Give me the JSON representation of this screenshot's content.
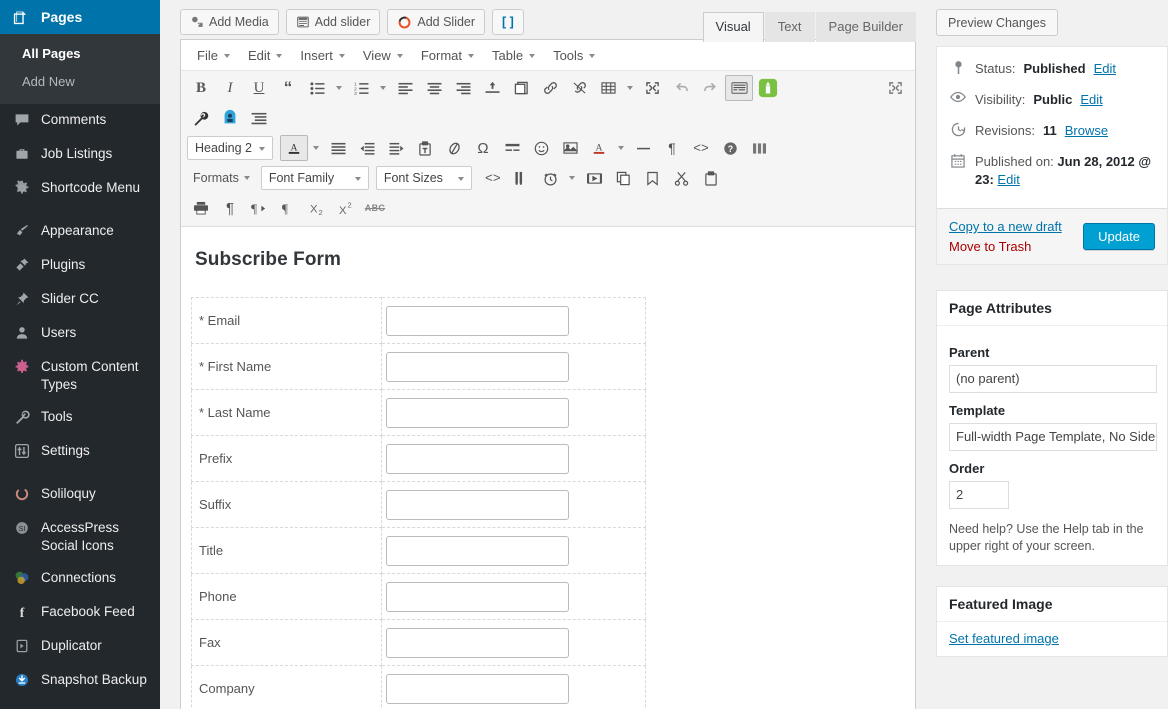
{
  "sidebar": {
    "current": {
      "label": "Pages",
      "icon": "pages-icon"
    },
    "submenu": [
      {
        "label": "All Pages",
        "current": true
      },
      {
        "label": "Add New",
        "current": false
      }
    ],
    "items": [
      {
        "label": "Comments",
        "icon": "comments-icon"
      },
      {
        "label": "Job Listings",
        "icon": "briefcase-icon"
      },
      {
        "label": "Shortcode Menu",
        "icon": "gear-icon"
      },
      {
        "label": "Appearance",
        "icon": "paintbrush-icon",
        "sep_before": true
      },
      {
        "label": "Plugins",
        "icon": "plug-icon"
      },
      {
        "label": "Slider CC",
        "icon": "pin-icon"
      },
      {
        "label": "Users",
        "icon": "user-icon"
      },
      {
        "label": "Custom Content Types",
        "icon": "custom-content-icon"
      },
      {
        "label": "Tools",
        "icon": "wrench-icon"
      },
      {
        "label": "Settings",
        "icon": "sliders-icon"
      },
      {
        "label": "Soliloquy",
        "icon": "soliloquy-icon",
        "sep_before": true
      },
      {
        "label": "AccessPress Social Icons",
        "icon": "accesspress-icon"
      },
      {
        "label": "Connections",
        "icon": "connections-icon"
      },
      {
        "label": "Facebook Feed",
        "icon": "facebook-icon"
      },
      {
        "label": "Duplicator",
        "icon": "duplicator-icon"
      },
      {
        "label": "Snapshot Backup",
        "icon": "download-circle-icon"
      }
    ]
  },
  "editor": {
    "media_buttons": [
      {
        "label": "Add Media",
        "icon": "add-media-icon"
      },
      {
        "label": "Add slider",
        "icon": "slider-icon"
      },
      {
        "label": "Add Slider",
        "icon": "soliloquy-ring-icon"
      },
      {
        "label": "[ ]",
        "icon": "shortcode-icon"
      }
    ],
    "tabs": [
      {
        "label": "Visual",
        "active": true
      },
      {
        "label": "Text",
        "active": false
      },
      {
        "label": "Page Builder",
        "active": false
      }
    ],
    "menubar": [
      "File",
      "Edit",
      "Insert",
      "View",
      "Format",
      "Table",
      "Tools"
    ],
    "toolbar_row1": [
      {
        "icon": "bold-icon",
        "glyph": "B"
      },
      {
        "icon": "italic-icon",
        "glyph": "I"
      },
      {
        "icon": "underline-icon",
        "glyph": "U"
      },
      {
        "icon": "blockquote-icon",
        "glyph": "“"
      },
      {
        "icon": "bullet-list-icon",
        "glyph": "",
        "caret": true
      },
      {
        "icon": "numbered-list-icon",
        "glyph": "",
        "caret": true
      },
      {
        "icon": "align-left-icon",
        "glyph": ""
      },
      {
        "icon": "align-center-icon",
        "glyph": ""
      },
      {
        "icon": "align-right-icon",
        "glyph": ""
      },
      {
        "icon": "insert-more-icon",
        "glyph": ""
      },
      {
        "icon": "page-break-icon",
        "glyph": ""
      },
      {
        "icon": "link-icon",
        "glyph": ""
      },
      {
        "icon": "unlink-icon",
        "glyph": ""
      },
      {
        "icon": "table-icon",
        "glyph": "",
        "caret": true
      },
      {
        "icon": "fullscreen-icon",
        "glyph": ""
      },
      {
        "icon": "undo-icon",
        "glyph": ""
      },
      {
        "icon": "redo-icon",
        "glyph": ""
      },
      {
        "icon": "keyboard-toolbar-toggle-icon",
        "glyph": "",
        "active": true
      },
      {
        "icon": "green-plugin-icon",
        "glyph": ""
      },
      {
        "icon": "distraction-free-icon",
        "glyph": ""
      }
    ],
    "toolbar_row2": [
      {
        "icon": "wrench-icon"
      },
      {
        "icon": "blue-badge-icon"
      },
      {
        "icon": "indent-lines-icon"
      }
    ],
    "format_select": "Heading 2",
    "toolbar_row3": [
      {
        "icon": "text-color-icon",
        "caret": true
      },
      {
        "icon": "justify-icon"
      },
      {
        "icon": "outdent-icon"
      },
      {
        "icon": "indent-icon"
      },
      {
        "icon": "paste-text-icon"
      },
      {
        "icon": "clear-formatting-icon"
      },
      {
        "icon": "special-character-icon",
        "glyph": "Ω"
      },
      {
        "icon": "insert-read-more-icon"
      },
      {
        "icon": "emoticon-icon"
      },
      {
        "icon": "insert-image-icon"
      },
      {
        "icon": "background-color-icon",
        "caret": true
      },
      {
        "icon": "horizontal-rule-icon"
      },
      {
        "icon": "show-blocks-icon",
        "glyph": "¶"
      },
      {
        "icon": "source-code-icon"
      },
      {
        "icon": "help-icon"
      },
      {
        "icon": "columns-icon"
      }
    ],
    "formats_label": "Formats",
    "font_family_select": "Font Family",
    "font_sizes_select": "Font Sizes",
    "toolbar_row4": [
      {
        "icon": "code-icon"
      },
      {
        "icon": "find-replace-icon"
      },
      {
        "icon": "insert-date-time-icon",
        "caret": true
      },
      {
        "icon": "insert-video-icon"
      },
      {
        "icon": "copy-icon"
      },
      {
        "icon": "anchor-icon"
      },
      {
        "icon": "cut-icon"
      },
      {
        "icon": "paste-icon"
      }
    ],
    "toolbar_row5": [
      {
        "icon": "print-icon"
      },
      {
        "icon": "paragraph-icon",
        "glyph": "¶"
      },
      {
        "icon": "ltr-icon"
      },
      {
        "icon": "rtl-icon"
      },
      {
        "icon": "subscript-icon"
      },
      {
        "icon": "superscript-icon"
      },
      {
        "icon": "strikethrough-icon",
        "glyph": "ABC"
      }
    ]
  },
  "form": {
    "title": "Subscribe Form",
    "fields": [
      {
        "label": "* Email",
        "value": ""
      },
      {
        "label": "* First Name",
        "value": ""
      },
      {
        "label": "* Last Name",
        "value": ""
      },
      {
        "label": "Prefix",
        "value": ""
      },
      {
        "label": "Suffix",
        "value": ""
      },
      {
        "label": "Title",
        "value": ""
      },
      {
        "label": "Phone",
        "value": ""
      },
      {
        "label": "Fax",
        "value": ""
      },
      {
        "label": "Company",
        "value": ""
      }
    ]
  },
  "publish": {
    "preview_label": "Preview Changes",
    "status_prefix": "Status:",
    "status_value": "Published",
    "status_edit": "Edit",
    "visibility_prefix": "Visibility:",
    "visibility_value": "Public",
    "visibility_edit": "Edit",
    "revisions_prefix": "Revisions:",
    "revisions_count": "11",
    "revisions_browse": "Browse",
    "published_prefix": "Published on:",
    "published_value": "Jun 28, 2012 @ 23:",
    "published_edit": "Edit",
    "copy_draft": "Copy to a new draft",
    "move_trash": "Move to Trash",
    "update_label": "Update"
  },
  "page_attributes": {
    "heading": "Page Attributes",
    "parent_label": "Parent",
    "parent_value": "(no parent)",
    "template_label": "Template",
    "template_value": "Full-width Page Template, No Sidebar",
    "order_label": "Order",
    "order_value": "2",
    "help_text": "Need help? Use the Help tab in the upper right of your screen."
  },
  "featured_image": {
    "heading": "Featured Image",
    "set_link": "Set featured image"
  },
  "colors": {
    "wp_blue": "#0073aa",
    "update_blue": "#00a0d2",
    "sidebar_bg": "#23282d",
    "submenu_bg": "#32373c",
    "trash_red": "#a00000"
  }
}
